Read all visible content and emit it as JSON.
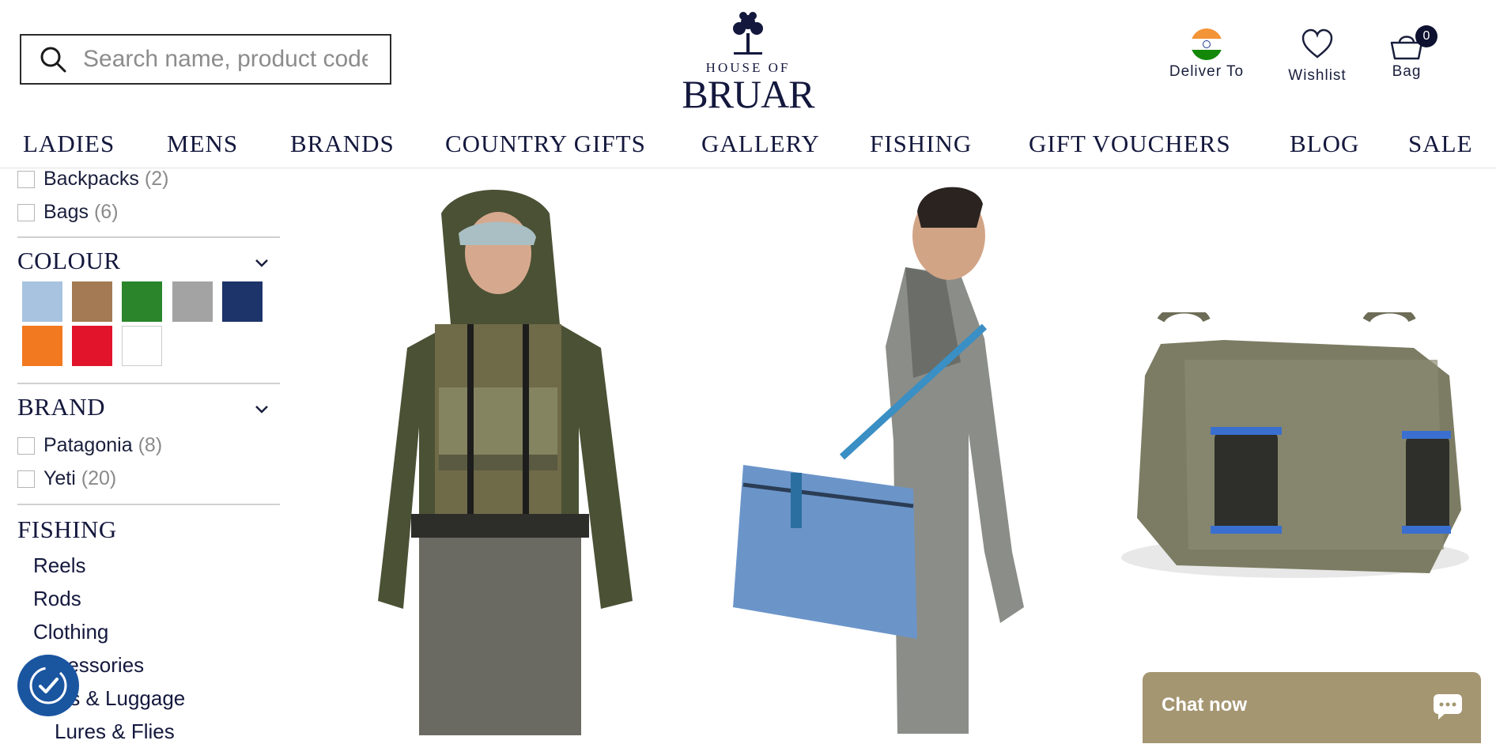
{
  "header": {
    "search_placeholder": "Search name, product code or keyword",
    "logo_line1": "HOUSE OF",
    "logo_line2": "BRUAR",
    "deliver_label": "Deliver To",
    "wishlist_label": "Wishlist",
    "bag_label": "Bag",
    "bag_count": "0"
  },
  "nav": [
    "LADIES",
    "MENS",
    "BRANDS",
    "COUNTRY GIFTS",
    "GALLERY",
    "FISHING",
    "GIFT VOUCHERS",
    "BLOG",
    "SALE"
  ],
  "sidebar": {
    "type_items": [
      {
        "label": "Backpacks",
        "count": "(2)"
      },
      {
        "label": "Bags",
        "count": "(6)"
      }
    ],
    "colour_title": "COLOUR",
    "colours": [
      "#a7c3df",
      "#a37a53",
      "#2a852b",
      "#a3a3a3",
      "#1d346a",
      "#f27920",
      "#e1142b",
      "#ffffff"
    ],
    "brand_title": "BRAND",
    "brand_items": [
      {
        "label": "Patagonia",
        "count": "(8)"
      },
      {
        "label": "Yeti",
        "count": "(20)"
      }
    ],
    "fishing_title": "FISHING",
    "fishing_links": [
      "Reels",
      "Rods",
      "Clothing",
      "Accessories",
      "Bags & Luggage",
      "Lures & Flies"
    ]
  },
  "chat_label": "Chat now",
  "icons": {
    "search": "search-icon",
    "flag": "india-flag-icon",
    "wishlist": "heart-icon",
    "bag": "shopping-bag-icon",
    "chat": "chat-bubble-icon",
    "accessibility": "accessibility-icon"
  }
}
